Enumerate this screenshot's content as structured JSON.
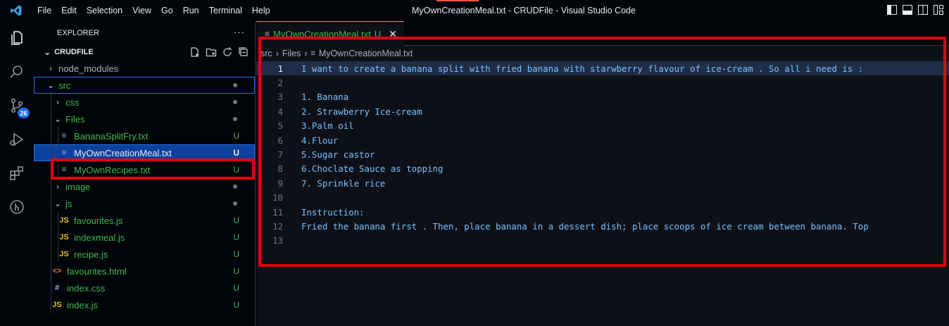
{
  "menu": [
    "File",
    "Edit",
    "Selection",
    "View",
    "Go",
    "Run",
    "Terminal",
    "Help"
  ],
  "window_title": "MyOwnCreationMeal.txt - CRUDFile - Visual Studio Code",
  "activity": {
    "source_control_badge": "26"
  },
  "sidebar": {
    "title": "EXPLORER",
    "more": "···",
    "section": "CRUDFILE",
    "tree": [
      {
        "label": "node_modules",
        "chev": "›",
        "indent": 0,
        "status": "",
        "color": "grey",
        "type": "folder"
      },
      {
        "label": "src",
        "chev": "⌄",
        "indent": 0,
        "status": "dot",
        "color": "green",
        "type": "folder"
      },
      {
        "label": "css",
        "chev": "›",
        "indent": 1,
        "status": "dot",
        "color": "green",
        "type": "folder"
      },
      {
        "label": "Files",
        "chev": "⌄",
        "indent": 1,
        "status": "dot",
        "color": "green",
        "type": "folder"
      },
      {
        "label": "BananaSplitFry.txt",
        "chev": "",
        "indent": 2,
        "status": "U",
        "color": "green",
        "type": "txt"
      },
      {
        "label": "MyOwnCreationMeal.txt",
        "chev": "",
        "indent": 2,
        "status": "U",
        "color": "white",
        "type": "txt",
        "selected": true
      },
      {
        "label": "MyOwnRecipes.txt",
        "chev": "",
        "indent": 2,
        "status": "U",
        "color": "green",
        "type": "txt"
      },
      {
        "label": "image",
        "chev": "›",
        "indent": 1,
        "status": "dot",
        "color": "green",
        "type": "folder"
      },
      {
        "label": "js",
        "chev": "⌄",
        "indent": 1,
        "status": "dot",
        "color": "green",
        "type": "folder"
      },
      {
        "label": "favourites.js",
        "chev": "",
        "indent": 2,
        "status": "U",
        "color": "green",
        "type": "js"
      },
      {
        "label": "indexmeal.js",
        "chev": "",
        "indent": 2,
        "status": "U",
        "color": "green",
        "type": "js"
      },
      {
        "label": "recipe.js",
        "chev": "",
        "indent": 2,
        "status": "U",
        "color": "green",
        "type": "js"
      },
      {
        "label": "favourites.html",
        "chev": "",
        "indent": 1,
        "status": "U",
        "color": "green",
        "type": "html"
      },
      {
        "label": "index.css",
        "chev": "",
        "indent": 1,
        "status": "U",
        "color": "green",
        "type": "css"
      },
      {
        "label": "index.js",
        "chev": "",
        "indent": 1,
        "status": "U",
        "color": "green",
        "type": "js"
      }
    ]
  },
  "editor": {
    "tab": {
      "label": "MyOwnCreationMeal.txt",
      "status": "U",
      "close": "✕"
    },
    "breadcrumb": [
      "src",
      "Files",
      "MyOwnCreationMeal.txt"
    ],
    "lines": [
      "I want to create a banana split with fried banana with starwberry flavour of ice-cream . So all i need is :",
      "",
      "1. Banana",
      "2. Strawberry Ice-cream",
      "3.Palm oil",
      "4.Flour",
      "5.Sugar castor",
      "6.Choclate Sauce as topping",
      "7. Sprinkle rice",
      "",
      "Instruction:",
      "Fried the banana first . Then, place banana in a dessert dish; place scoops of ice cream between banana. Top",
      ""
    ]
  },
  "colors": {
    "accent_red": "#e1000f",
    "untracked_green": "#3fb950",
    "selection_blue": "#0d419d"
  }
}
